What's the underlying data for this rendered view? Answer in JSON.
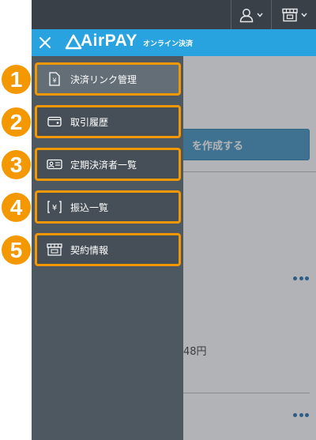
{
  "header": {
    "user_icon": "user-icon",
    "store_icon": "store-icon"
  },
  "brand": {
    "name": "AirPAY",
    "subtitle": "オンライン決済"
  },
  "page": {
    "create_button_label": "を作成する",
    "amount_fragment": "48円"
  },
  "callouts": [
    "1",
    "2",
    "3",
    "4",
    "5"
  ],
  "menu": {
    "items": [
      {
        "label": "決済リンク管理",
        "icon": "payment-link-icon",
        "active": true
      },
      {
        "label": "取引履歴",
        "icon": "wallet-icon",
        "active": false
      },
      {
        "label": "定期決済者一覧",
        "icon": "id-card-icon",
        "active": false
      },
      {
        "label": "振込一覧",
        "icon": "yen-transfer-icon",
        "active": false
      },
      {
        "label": "契約情報",
        "icon": "shop-contract-icon",
        "active": false
      }
    ]
  },
  "colors": {
    "topbar": "#3a4047",
    "brand_blue": "#29a3e0",
    "drawer": "#4e5861",
    "highlight_orange": "#f39800",
    "primary_button": "#3b8fc0"
  }
}
